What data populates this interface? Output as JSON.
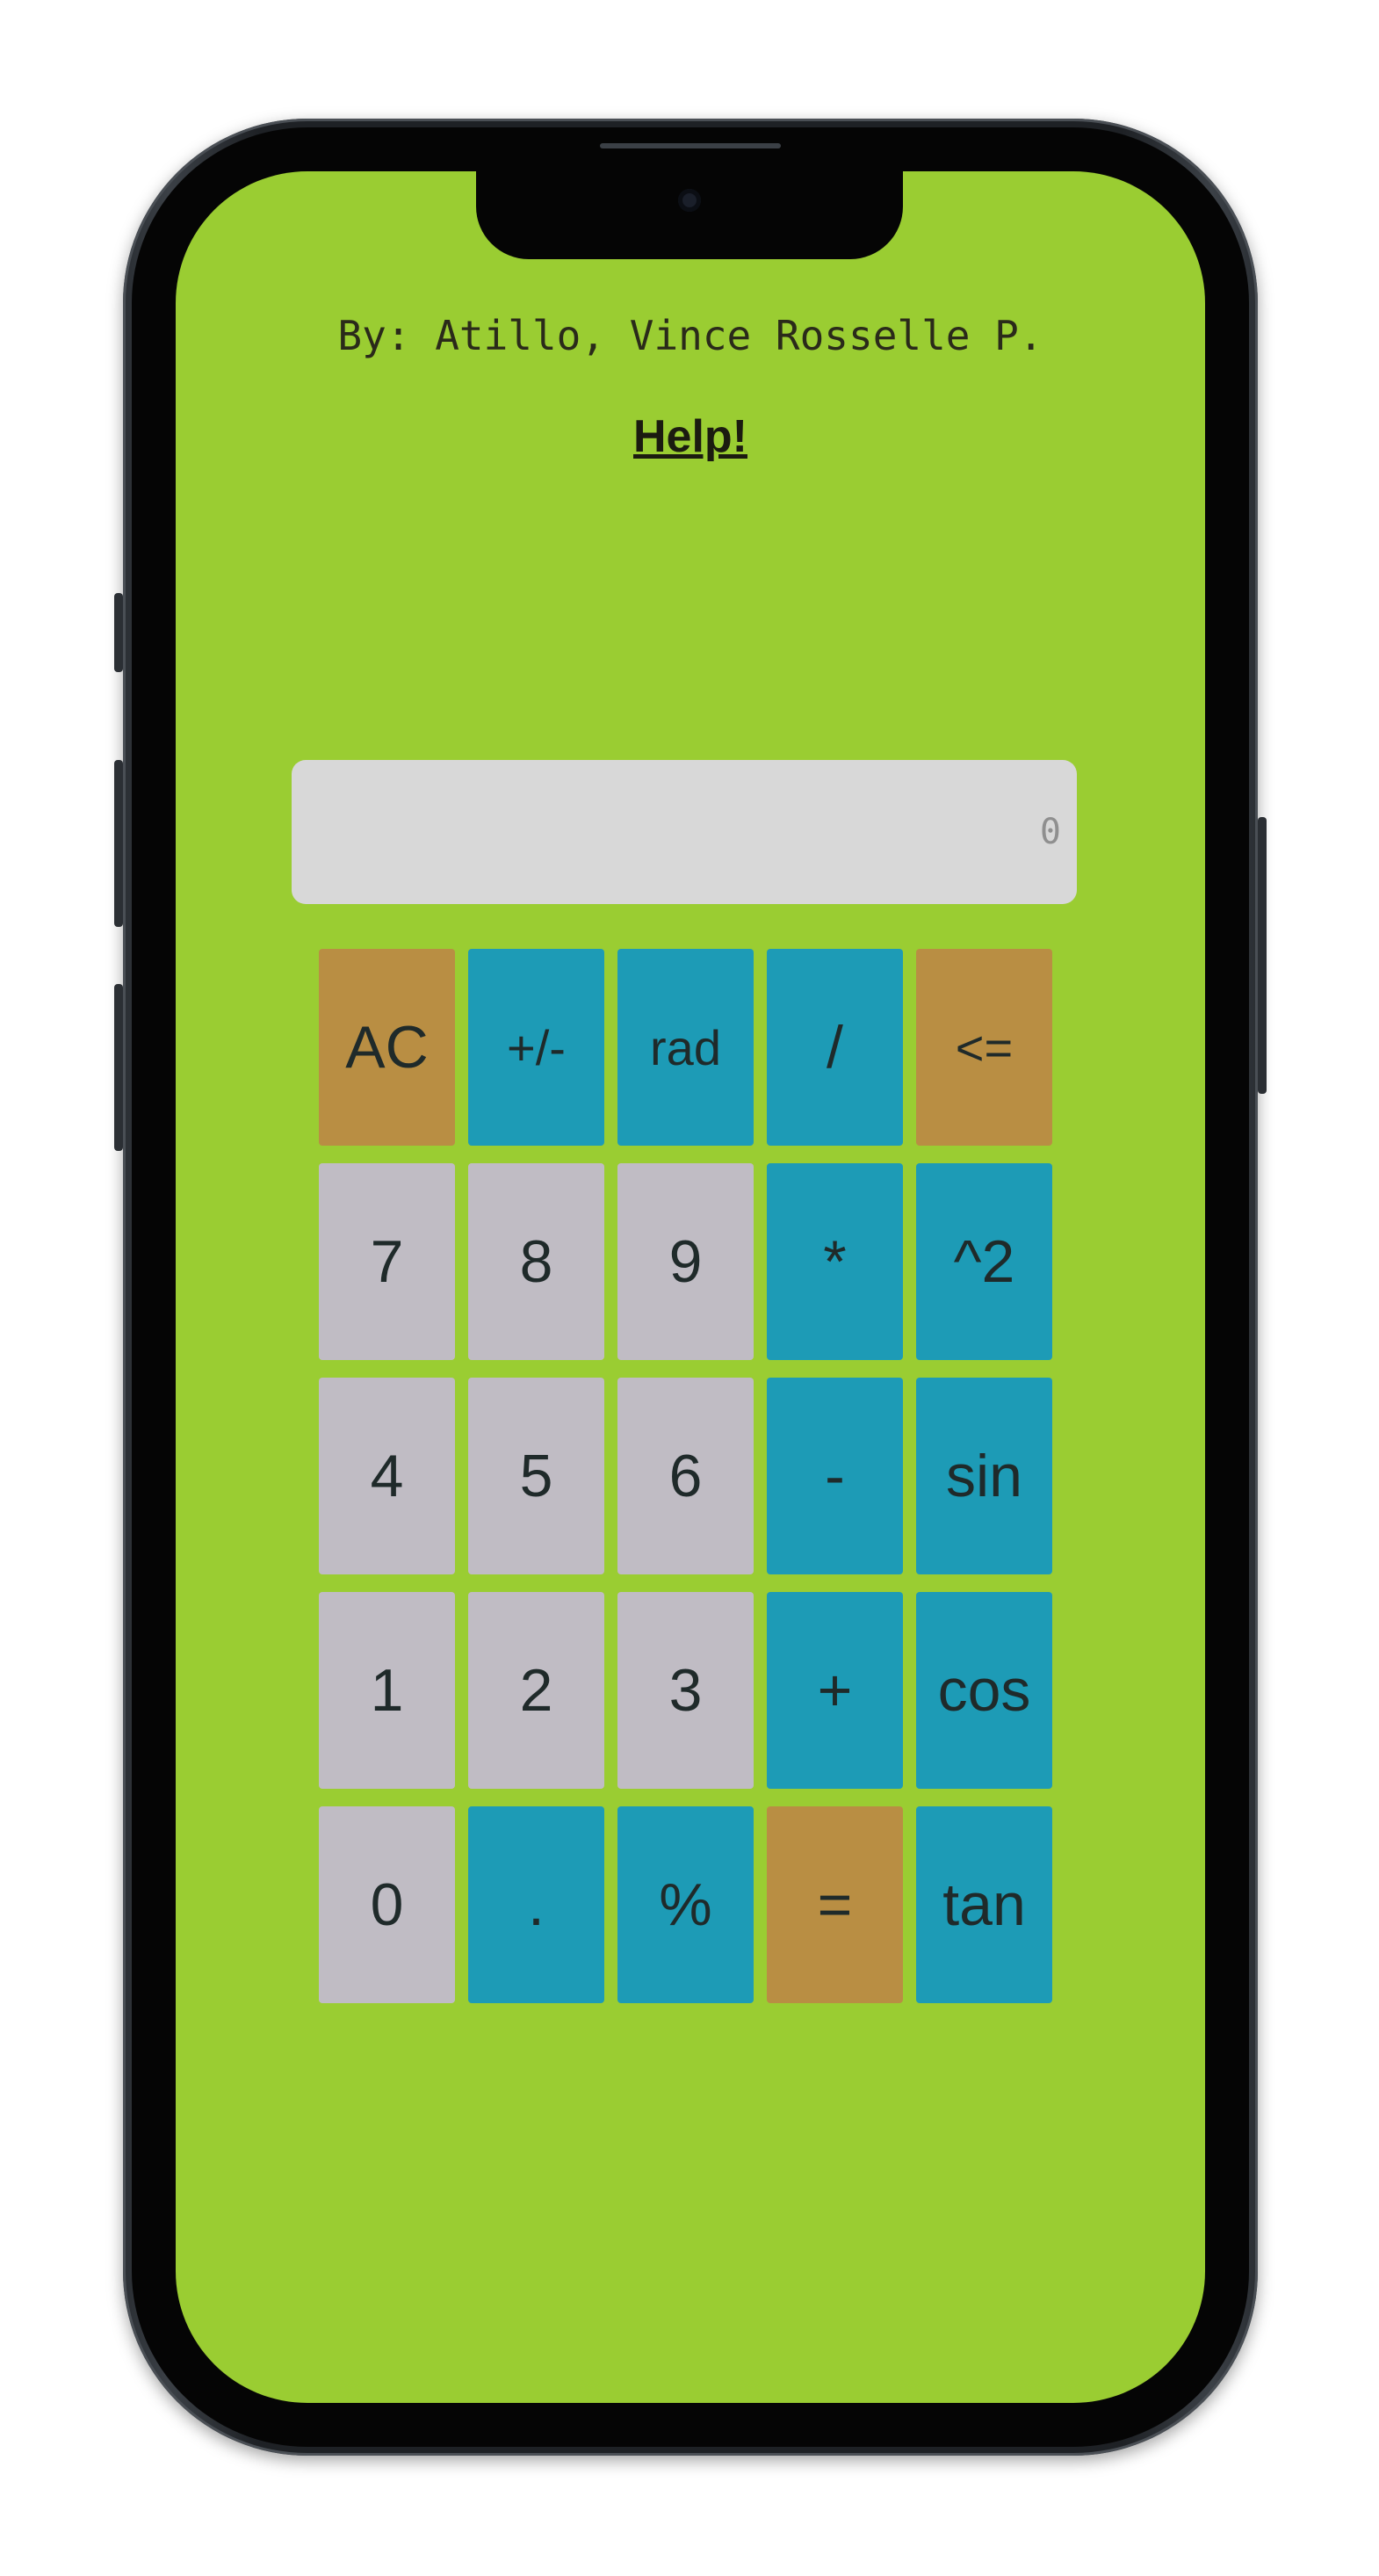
{
  "header": {
    "byline": "By: Atillo, Vince Rosselle P.",
    "help_link": "Help!"
  },
  "display": {
    "value": "0"
  },
  "keypad": {
    "keys": [
      {
        "label": "AC",
        "kind": "fn"
      },
      {
        "label": "+/-",
        "kind": "op"
      },
      {
        "label": "rad",
        "kind": "op"
      },
      {
        "label": "/",
        "kind": "op"
      },
      {
        "label": "<=",
        "kind": "fn"
      },
      {
        "label": "7",
        "kind": "num"
      },
      {
        "label": "8",
        "kind": "num"
      },
      {
        "label": "9",
        "kind": "num"
      },
      {
        "label": "*",
        "kind": "op"
      },
      {
        "label": "^2",
        "kind": "op"
      },
      {
        "label": "4",
        "kind": "num"
      },
      {
        "label": "5",
        "kind": "num"
      },
      {
        "label": "6",
        "kind": "num"
      },
      {
        "label": "-",
        "kind": "op"
      },
      {
        "label": "sin",
        "kind": "op"
      },
      {
        "label": "1",
        "kind": "num"
      },
      {
        "label": "2",
        "kind": "num"
      },
      {
        "label": "3",
        "kind": "num"
      },
      {
        "label": "+",
        "kind": "op"
      },
      {
        "label": "cos",
        "kind": "op"
      },
      {
        "label": "0",
        "kind": "num"
      },
      {
        "label": ".",
        "kind": "op"
      },
      {
        "label": "%",
        "kind": "op"
      },
      {
        "label": "=",
        "kind": "fn"
      },
      {
        "label": "tan",
        "kind": "op"
      }
    ]
  },
  "colors": {
    "background": "#9acd32",
    "number_key": "#c0bcc4",
    "operator_key": "#1d9bb6",
    "function_key": "#b98e43",
    "display": "#d8d8d8"
  }
}
